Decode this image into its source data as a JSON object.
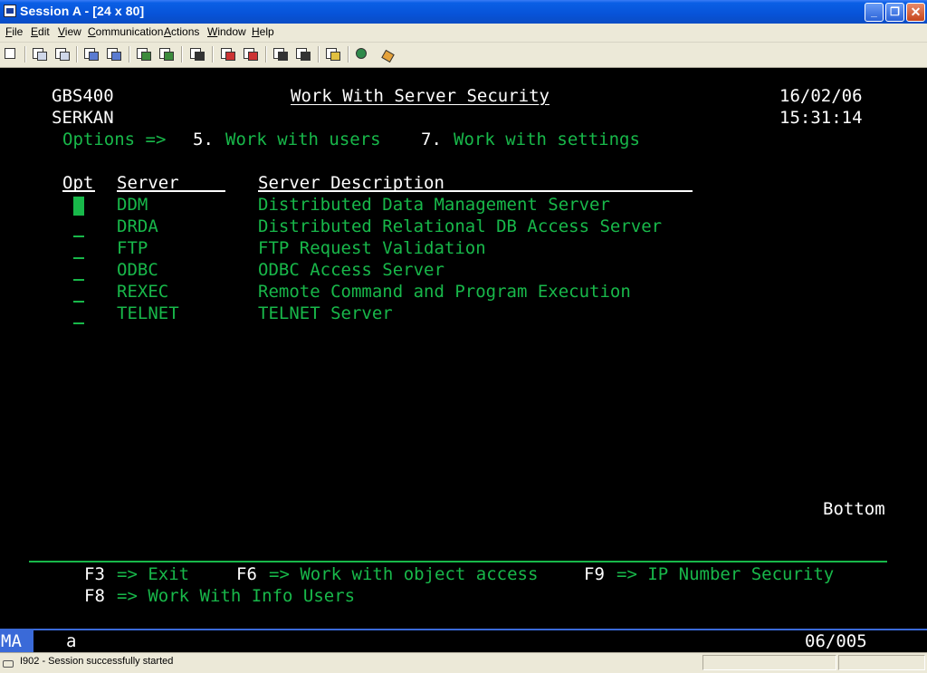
{
  "window": {
    "title": "Session A - [24 x 80]"
  },
  "menu": [
    "File",
    "Edit",
    "View",
    "Communication",
    "Actions",
    "Window",
    "Help"
  ],
  "toolbar_icons": [
    "print-screen-icon",
    "copy-icon",
    "paste-icon",
    "send-icon",
    "receive-icon",
    "display-icon",
    "preferences-icon",
    "macro-icon",
    "record-icon",
    "stop-icon",
    "play-icon",
    "play-macro-icon",
    "clipboard-icon",
    "globe-icon",
    "key-icon"
  ],
  "screen": {
    "system": "GBS400",
    "user": "SERKAN",
    "title": "Work With Server Security",
    "date": "16/02/06",
    "time": "15:31:14",
    "options_label": "Options =>",
    "option5": "5. Work with users",
    "option7": "7. Work with settings",
    "col_opt": "Opt",
    "col_server": "Server",
    "col_desc": "Server Description",
    "rows": [
      {
        "server": "DDM",
        "desc": "Distributed Data Management Server"
      },
      {
        "server": "DRDA",
        "desc": "Distributed Relational DB Access Server"
      },
      {
        "server": "FTP",
        "desc": "FTP Request Validation"
      },
      {
        "server": "ODBC",
        "desc": "ODBC Access Server"
      },
      {
        "server": "REXEC",
        "desc": "Remote Command and Program Execution"
      },
      {
        "server": "TELNET",
        "desc": "TELNET Server"
      }
    ],
    "bottom": "Bottom",
    "fkeys": {
      "f3": "F3",
      "f3_label": "=> Exit",
      "f6": "F6",
      "f6_label": "=> Work with object access",
      "f9": "F9",
      "f9_label": "=> IP Number Security",
      "f8": "F8",
      "f8_label": "=> Work With Info Users"
    }
  },
  "oia": {
    "mode": "MA",
    "indicator": "a",
    "cursor_pos": "06/005"
  },
  "status": {
    "message": "I902 - Session successfully started"
  }
}
